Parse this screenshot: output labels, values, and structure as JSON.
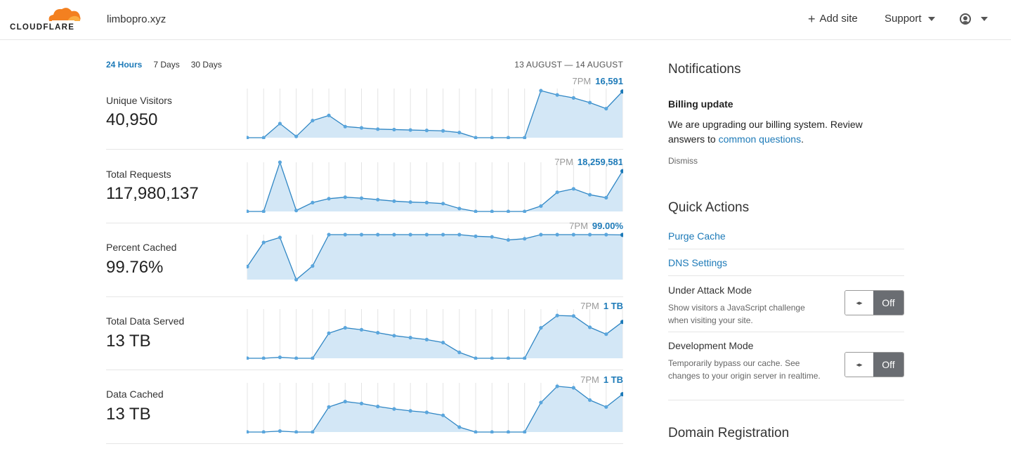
{
  "header": {
    "brand": "CLOUDFLARE",
    "zone": "limbopro.xyz",
    "add_site": "Add site",
    "support": "Support",
    "plus_icon": "plus-icon",
    "user_icon": "user-icon",
    "brand_color": "#f38020"
  },
  "range": {
    "tabs": [
      "24 Hours",
      "7 Days",
      "30 Days"
    ],
    "active": "24 Hours",
    "dates": "13 AUGUST — 14 AUGUST"
  },
  "colors": {
    "accent": "#1d7ab8",
    "series_line": "#2f86c4",
    "series_fill": "#d3e7f6",
    "series_point": "#5aa6dd"
  },
  "metrics": [
    {
      "label": "Unique Visitors",
      "value": "40,950",
      "peak_time": "7PM",
      "peak_value": "16,591",
      "series": [
        0,
        0,
        33,
        3,
        40,
        52,
        26,
        23,
        20,
        19,
        18,
        17,
        16,
        12,
        0,
        0,
        0,
        0,
        110,
        100,
        93,
        82,
        68,
        108
      ]
    },
    {
      "label": "Total Requests",
      "value": "117,980,137",
      "peak_time": "7PM",
      "peak_value": "18,259,581",
      "series": [
        0,
        0,
        100,
        2,
        18,
        26,
        29,
        27,
        24,
        21,
        19,
        18,
        16,
        6,
        0,
        0,
        0,
        0,
        11,
        39,
        46,
        34,
        28,
        82
      ]
    },
    {
      "label": "Percent Cached",
      "value": "99.76%",
      "peak_time": "7PM",
      "peak_value": "99.00%",
      "series": [
        97.2,
        99.15,
        99.55,
        96.15,
        97.25,
        99.78,
        99.78,
        99.78,
        99.78,
        99.78,
        99.78,
        99.78,
        99.78,
        99.78,
        99.65,
        99.6,
        99.35,
        99.45,
        99.78,
        99.78,
        99.78,
        99.78,
        99.78,
        99.76
      ]
    },
    {
      "label": "Total Data Served",
      "value": "13 TB",
      "peak_time": "7PM",
      "peak_value": "1 TB",
      "series": [
        0,
        0,
        2,
        0,
        0,
        51,
        62,
        58,
        52,
        46,
        42,
        38,
        32,
        12,
        0,
        0,
        0,
        0,
        62,
        87,
        86,
        63,
        49,
        74
      ]
    },
    {
      "label": "Data Cached",
      "value": "13 TB",
      "peak_time": "7PM",
      "peak_value": "1 TB",
      "series": [
        0,
        0,
        2,
        0,
        0,
        51,
        62,
        58,
        52,
        47,
        43,
        40,
        34,
        10,
        0,
        0,
        0,
        0,
        60,
        93,
        90,
        65,
        51,
        77
      ]
    }
  ],
  "notifications": {
    "heading": "Notifications",
    "title": "Billing update",
    "body": "We are upgrading our billing system. Review answers to ",
    "link": "common questions",
    "suffix": ".",
    "dismiss": "Dismiss"
  },
  "quick_actions": {
    "heading": "Quick Actions",
    "purge": "Purge Cache",
    "dns": "DNS Settings",
    "under_attack": {
      "title": "Under Attack Mode",
      "desc": "Show visitors a JavaScript challenge when visiting your site.",
      "state": "Off"
    },
    "dev_mode": {
      "title": "Development Mode",
      "desc": "Temporarily bypass our cache. See changes to your origin server in realtime.",
      "state": "Off"
    }
  },
  "domain_registration": {
    "heading": "Domain Registration"
  }
}
